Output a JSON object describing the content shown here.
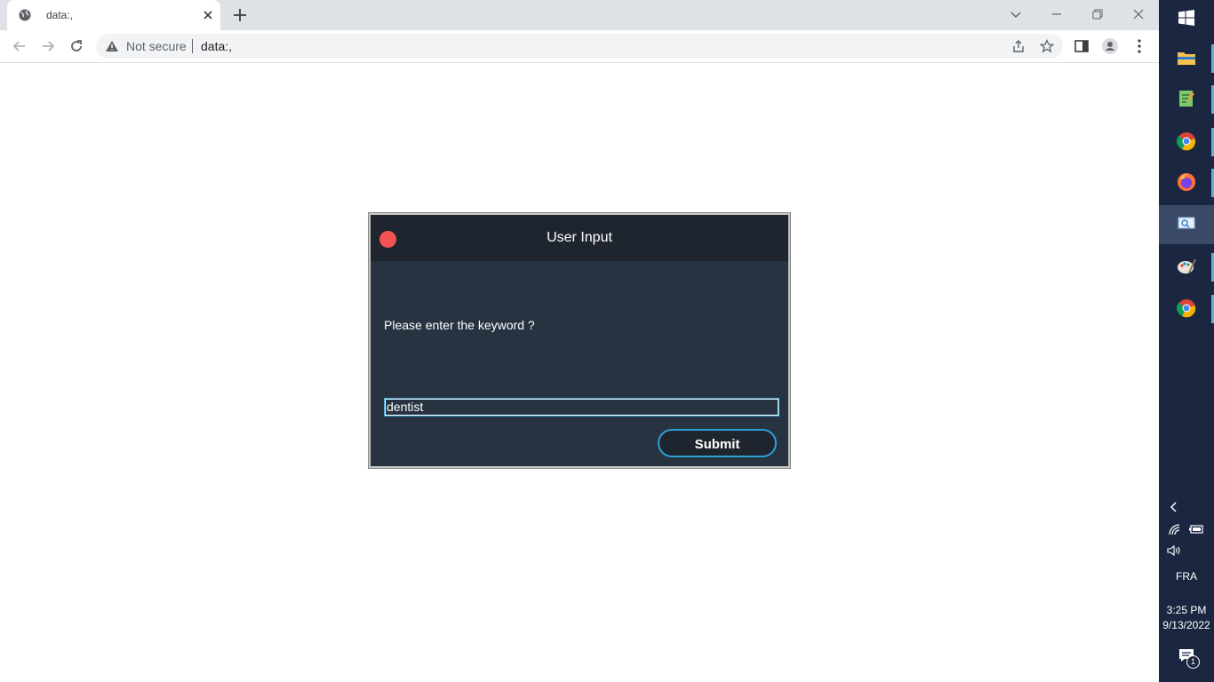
{
  "browser": {
    "tab_title": "data:,",
    "security_label": "Not secure",
    "url": "data:,"
  },
  "dialog": {
    "title": "User Input",
    "prompt": "Please enter the keyword ?",
    "input_value": "dentist",
    "submit_label": "Submit"
  },
  "taskbar": {
    "language": "FRA",
    "time": "3:25 PM",
    "date": "9/13/2022",
    "notification_count": "1"
  },
  "colors": {
    "dialog_bg": "#283341",
    "dialog_header": "#1f252e",
    "close_dot": "#f55353",
    "accent": "#2b9fd6",
    "taskbar_bg": "#1b2740"
  }
}
